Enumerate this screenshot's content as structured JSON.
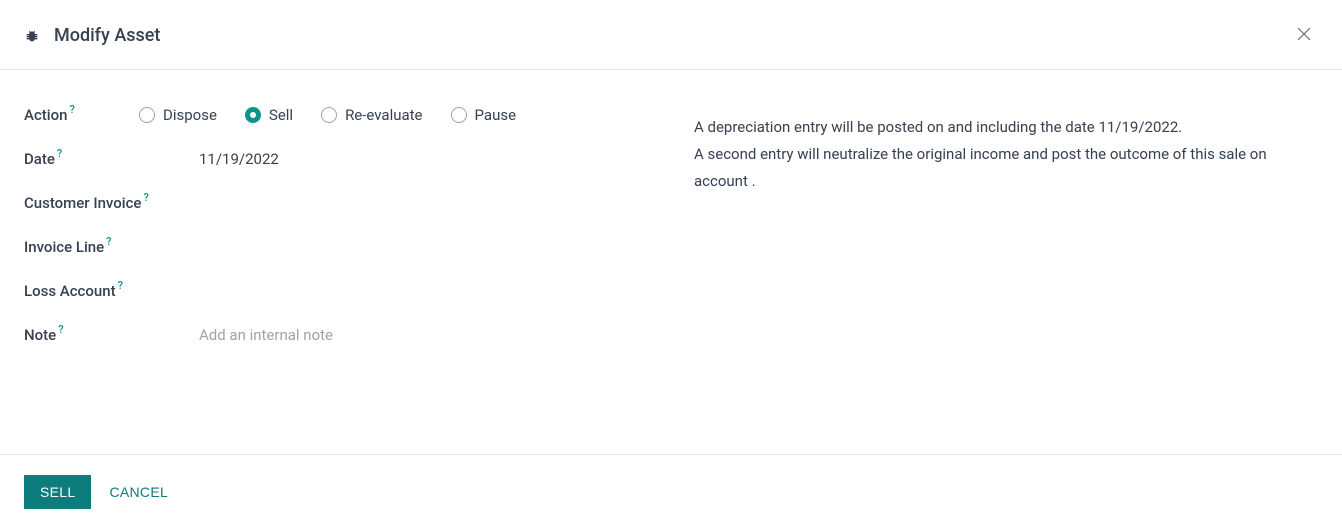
{
  "header": {
    "title": "Modify Asset"
  },
  "form": {
    "action": {
      "label": "Action",
      "options": [
        {
          "label": "Dispose",
          "selected": false
        },
        {
          "label": "Sell",
          "selected": true
        },
        {
          "label": "Re-evaluate",
          "selected": false
        },
        {
          "label": "Pause",
          "selected": false
        }
      ]
    },
    "date": {
      "label": "Date",
      "value": "11/19/2022"
    },
    "customer_invoice": {
      "label": "Customer Invoice",
      "value": ""
    },
    "invoice_line": {
      "label": "Invoice Line",
      "value": ""
    },
    "loss_account": {
      "label": "Loss Account",
      "value": ""
    },
    "note": {
      "label": "Note",
      "placeholder": "Add an internal note",
      "value": ""
    }
  },
  "info": {
    "line1": "A depreciation entry will be posted on and including the date 11/19/2022.",
    "line2": "A second entry will neutralize the original income and post the outcome of this sale on account ."
  },
  "footer": {
    "primary": "SELL",
    "secondary": "CANCEL"
  }
}
